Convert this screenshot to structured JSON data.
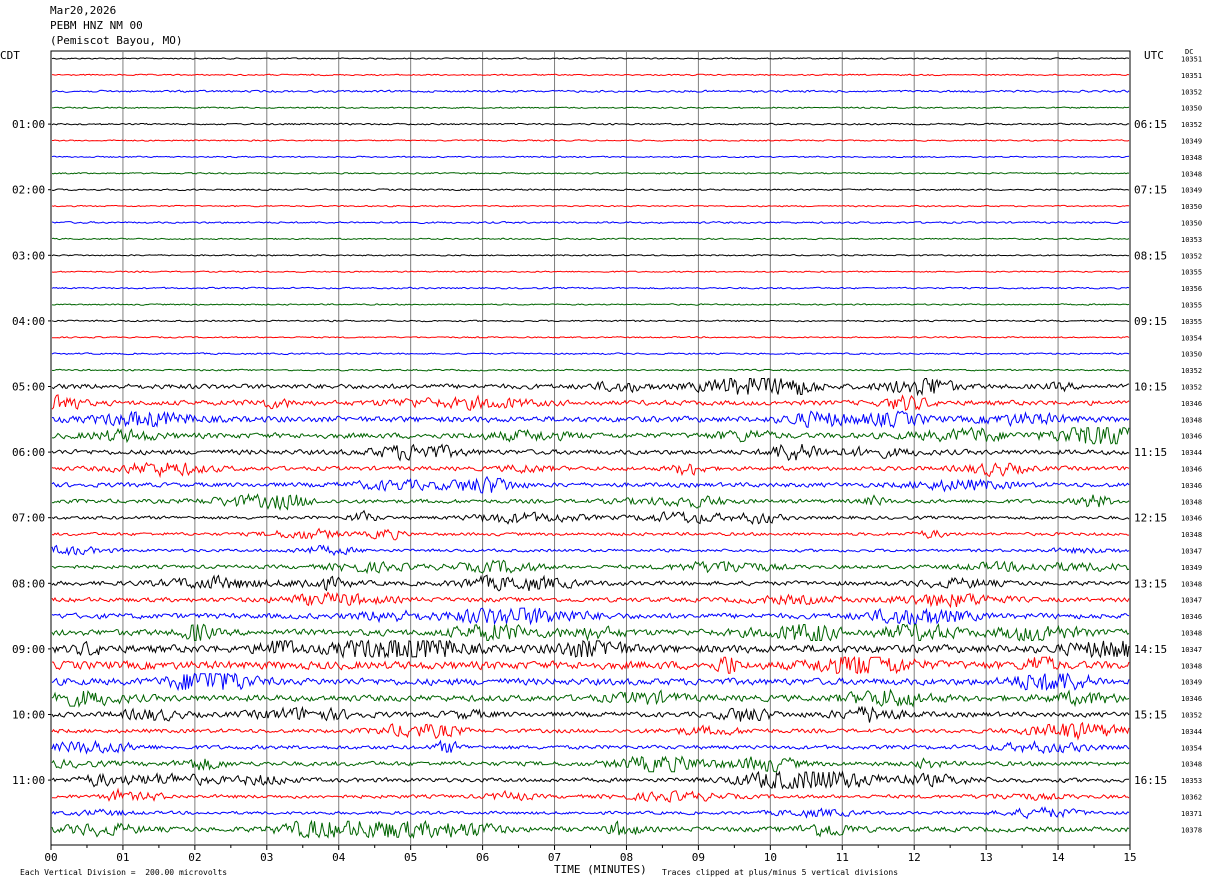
{
  "header": {
    "date": "Mar20,2026",
    "station": "PEBM HNZ NM 00",
    "location": "(Pemiscot Bayou, MO)"
  },
  "left_zone": "CDT",
  "right_zone": "UTC",
  "dc_label": "DC",
  "footer": {
    "scale": "Each Vertical Division =  200.00 microvolts",
    "clip": "Traces clipped at plus/minus 5 vertical divisions"
  },
  "colors": {
    "trace": [
      "#000000",
      "#ff0000",
      "#0000ff",
      "#006400"
    ],
    "grid": "#7f7f7f"
  },
  "chart_data": {
    "type": "line",
    "xlabel": "TIME (MINUTES)",
    "xlim": [
      0,
      15
    ],
    "x_ticks": [
      "00",
      "01",
      "02",
      "03",
      "04",
      "05",
      "06",
      "07",
      "08",
      "09",
      "10",
      "11",
      "12",
      "13",
      "14",
      "15"
    ],
    "rows": 48,
    "left_hour_labels": [
      "01:00",
      "02:00",
      "03:00",
      "04:00",
      "05:00",
      "06:00",
      "07:00",
      "08:00",
      "09:00",
      "10:00",
      "11:00"
    ],
    "right_hour_labels": [
      "06:15",
      "07:15",
      "08:15",
      "09:15",
      "10:15",
      "11:15",
      "12:15",
      "13:15",
      "14:15",
      "15:15",
      "16:15"
    ],
    "dc_values": [
      "10351",
      "10351",
      "10352",
      "10350",
      "10352",
      "10349",
      "10348",
      "10348",
      "10349",
      "10350",
      "10350",
      "10353",
      "10352",
      "10355",
      "10356",
      "10355",
      "10355",
      "10354",
      "10350",
      "10352",
      "10352",
      "10346",
      "10348",
      "10346",
      "10344",
      "10346",
      "10346",
      "10348",
      "10346",
      "10348",
      "10347",
      "10349",
      "10348",
      "10347",
      "10346",
      "10348",
      "10347",
      "10348",
      "10349",
      "10346",
      "10352",
      "10344",
      "10354",
      "10348",
      "10353",
      "10362",
      "10371",
      "10378"
    ],
    "row_noise_level": [
      0.6,
      0.6,
      0.9,
      0.6,
      0.7,
      0.6,
      0.6,
      0.6,
      0.7,
      0.6,
      0.8,
      0.6,
      0.6,
      0.6,
      0.7,
      0.6,
      0.7,
      0.6,
      0.7,
      0.7,
      2.2,
      2.2,
      2.6,
      2.4,
      2.2,
      1.9,
      2.0,
      1.8,
      1.5,
      1.4,
      1.3,
      1.6,
      2.0,
      2.0,
      2.4,
      2.8,
      3.5,
      3.6,
      3.0,
      2.8,
      2.2,
      1.8,
      1.8,
      2.0,
      1.9,
      1.6,
      1.4,
      2.2
    ]
  }
}
